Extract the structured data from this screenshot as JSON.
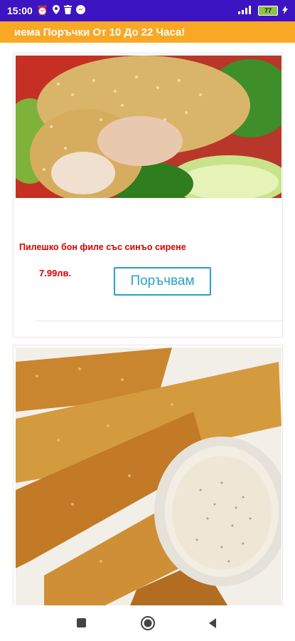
{
  "status_bar": {
    "time": "15:00",
    "battery": "77",
    "icons": [
      "alarm-icon",
      "location-icon",
      "trash-icon",
      "messenger-icon",
      "signal-icon",
      "battery-icon",
      "charging-icon"
    ]
  },
  "marquee": {
    "text": "иема Поръчки От 10 До 22 Часа!"
  },
  "products": [
    {
      "name": "Пилешко бон филе със синъо сирене",
      "price": "7.99лв.",
      "button": "Поръчвам"
    }
  ],
  "colors": {
    "status_bar": "#3d14c2",
    "marquee": "#f9a825",
    "accent": "#29a0c7",
    "price_red": "#d50000"
  }
}
